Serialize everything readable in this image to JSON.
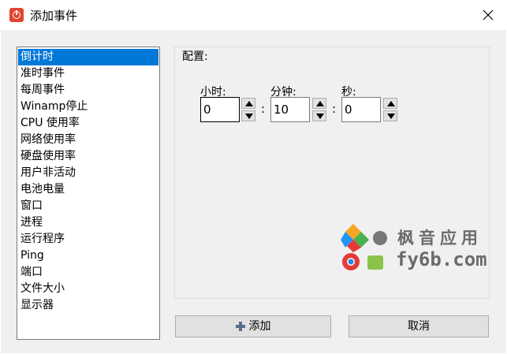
{
  "window": {
    "title": "添加事件"
  },
  "event_list": {
    "selected_index": 0,
    "items": [
      "倒计时",
      "准时事件",
      "每周事件",
      "Winamp停止",
      "CPU 使用率",
      "网络使用率",
      "硬盘使用率",
      "用户非活动",
      "电池电量",
      "窗口",
      "进程",
      "运行程序",
      "Ping",
      "端口",
      "文件大小",
      "显示器"
    ]
  },
  "config": {
    "group_title": "配置:",
    "hours": {
      "label": "小时:",
      "value": "0"
    },
    "minutes": {
      "label": "分钟:",
      "value": "10"
    },
    "seconds": {
      "label": "秒:",
      "value": "0"
    },
    "separator": ":"
  },
  "buttons": {
    "add_label": "添加",
    "cancel_label": "取消"
  },
  "watermark": {
    "line1": "枫音应用",
    "line2": "fy6b.com"
  },
  "colors": {
    "selection": "#0078d7",
    "app_icon": "#e0442f",
    "plus_icon": "#5a6e8c"
  }
}
